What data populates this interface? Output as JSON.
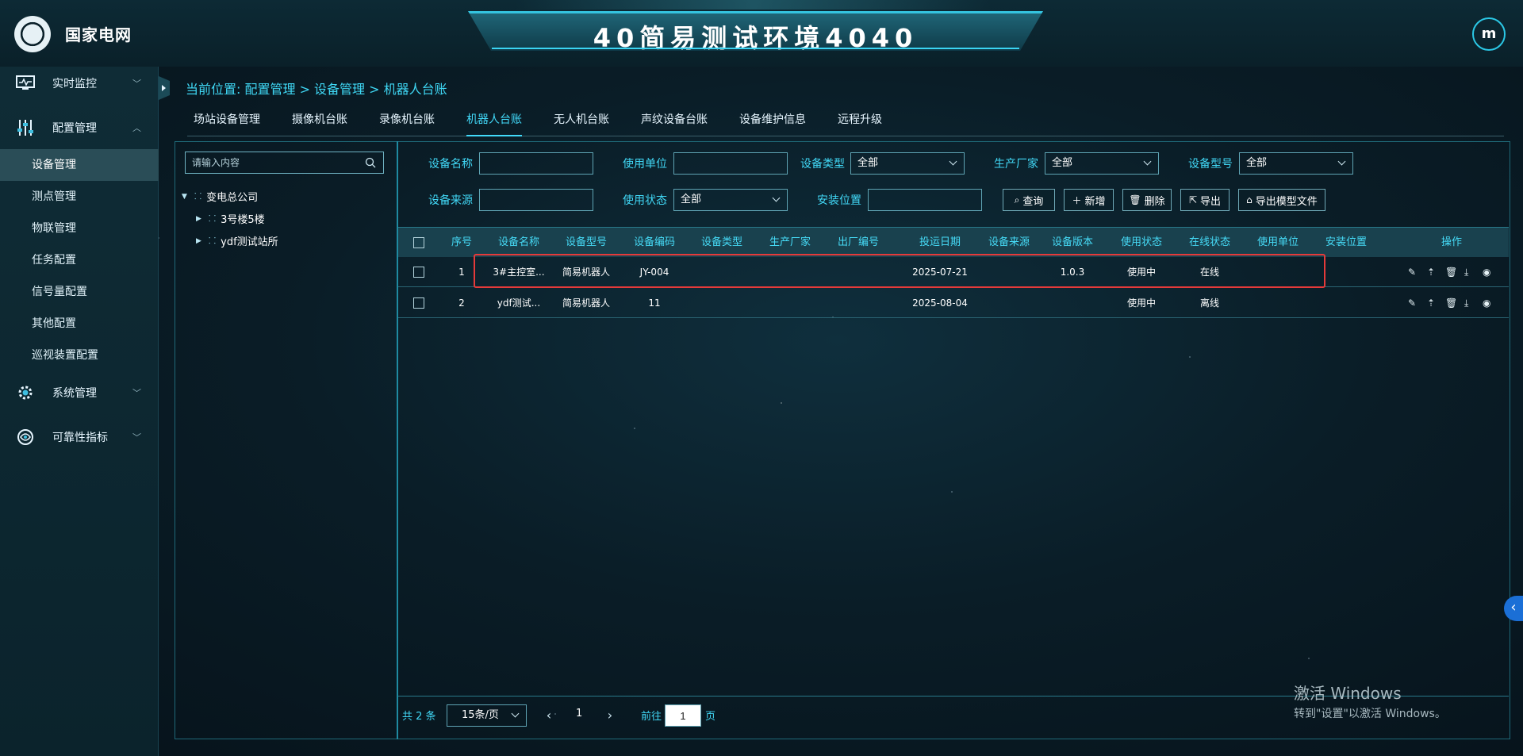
{
  "header": {
    "brand": "国家电网",
    "title": "40简易测试环境4040",
    "avatar_letter": "m"
  },
  "sidebar": {
    "menus": [
      {
        "label": "实时监控",
        "icon": "monitor-icon"
      },
      {
        "label": "配置管理",
        "icon": "sliders-icon"
      },
      {
        "label": "系统管理",
        "icon": "gear-icon"
      },
      {
        "label": "可靠性指标",
        "icon": "target-icon"
      }
    ],
    "submenus": [
      "设备管理",
      "测点管理",
      "物联管理",
      "任务配置",
      "信号量配置",
      "其他配置",
      "巡视装置配置"
    ]
  },
  "breadcrumb": "当前位置:  配置管理 > 设备管理 > 机器人台账",
  "tabs": [
    "场站设备管理",
    "摄像机台账",
    "录像机台账",
    "机器人台账",
    "无人机台账",
    "声纹设备台账",
    "设备维护信息",
    "远程升级"
  ],
  "tree": {
    "search_placeholder": "请输入内容",
    "root": "变电总公司",
    "children": [
      "3号楼5楼",
      "ydf测试站所"
    ]
  },
  "filters": {
    "device_name": "设备名称",
    "use_unit": "使用单位",
    "device_type": "设备类型",
    "device_type_value": "全部",
    "manufacturer": "生产厂家",
    "manufacturer_value": "全部",
    "device_model": "设备型号",
    "device_model_value": "全部",
    "device_source": "设备来源",
    "use_status": "使用状态",
    "use_status_value": "全部",
    "install_location": "安装位置"
  },
  "buttons": {
    "query": "查询",
    "add": "新增",
    "delete": "删除",
    "export": "导出",
    "export_model": "导出模型文件"
  },
  "table": {
    "headers": [
      "序号",
      "设备名称",
      "设备型号",
      "设备编码",
      "设备类型",
      "生产厂家",
      "出厂编号",
      "投运日期",
      "设备来源",
      "设备版本",
      "使用状态",
      "在线状态",
      "使用单位",
      "安装位置",
      "操作"
    ],
    "rows": [
      {
        "no": "1",
        "name": "3#主控室...",
        "model": "简易机器人",
        "code": "JY-004",
        "type": "",
        "maker": "",
        "serial": "",
        "date": "2025-07-21",
        "source": "",
        "version": "1.0.3",
        "use_status": "使用中",
        "online": "在线",
        "unit": "",
        "location": ""
      },
      {
        "no": "2",
        "name": "ydf测试...",
        "model": "简易机器人",
        "code": "11",
        "type": "",
        "maker": "",
        "serial": "",
        "date": "2025-08-04",
        "source": "",
        "version": "",
        "use_status": "使用中",
        "online": "离线",
        "unit": "",
        "location": ""
      }
    ]
  },
  "pagination": {
    "total": "共 2 条",
    "page_size": "15条/页",
    "current": "1",
    "goto_label": "前往",
    "goto_value": "1",
    "unit": "页"
  },
  "watermark": {
    "line1": "激活 Windows",
    "line2": "转到\"设置\"以激活 Windows。"
  },
  "colors": {
    "accent": "#42dafa",
    "highlight": "#e53a3a"
  }
}
